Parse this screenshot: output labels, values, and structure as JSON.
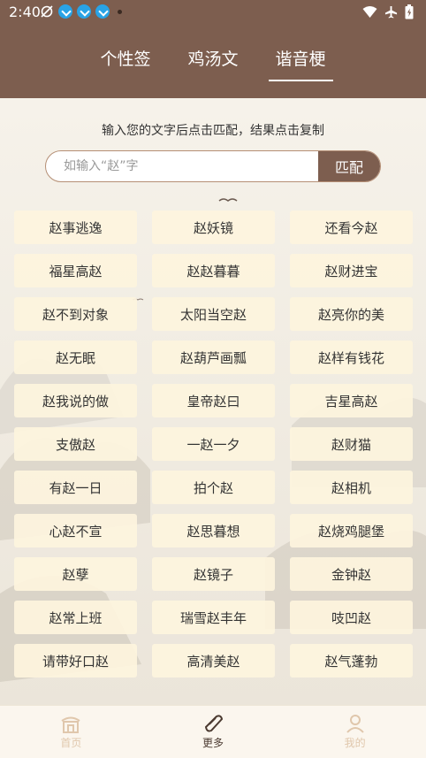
{
  "status_bar": {
    "time": "2:40"
  },
  "tabs": [
    {
      "label": "个性签"
    },
    {
      "label": "鸡汤文"
    },
    {
      "label": "谐音梗"
    }
  ],
  "hint": "输入您的文字后点击匹配，结果点击复制",
  "search": {
    "placeholder": "如输入“赵”字",
    "button_label": "匹配"
  },
  "results": [
    "赵事逃逸",
    "赵妖镜",
    "还看今赵",
    "福星高赵",
    "赵赵暮暮",
    "赵财进宝",
    "赵不到对象",
    "太阳当空赵",
    "赵亮你的美",
    "赵无眠",
    "赵葫芦画瓢",
    "赵样有钱花",
    "赵我说的做",
    "皇帝赵曰",
    "吉星高赵",
    "支傲赵",
    "一赵一夕",
    "赵财猫",
    "有赵一日",
    "拍个赵",
    "赵相机",
    "心赵不宣",
    "赵思暮想",
    "赵烧鸡腿堡",
    "赵孽",
    "赵镜子",
    "金钟赵",
    "赵常上班",
    "瑞雪赵丰年",
    "吱凹赵",
    "请带好口赵",
    "高清美赵",
    "赵气蓬勃"
  ],
  "bottom_nav": [
    {
      "label": "首页",
      "icon": "home-icon"
    },
    {
      "label": "更多",
      "icon": "scroll-icon"
    },
    {
      "label": "我的",
      "icon": "profile-icon"
    }
  ],
  "colors": {
    "primary": "#7d5e4f",
    "cell_bg": "#fdf4de",
    "nav_inactive": "#e0c7ac"
  }
}
